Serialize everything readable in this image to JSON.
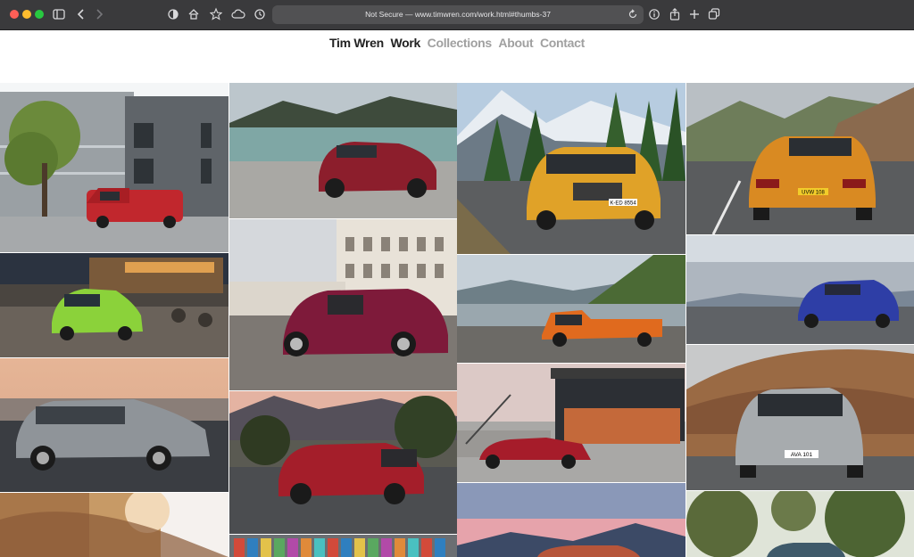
{
  "browser": {
    "url_text": "Not Secure — www.timwren.com/work.html#thumbs-37"
  },
  "nav": {
    "owner": "Tim Wren",
    "items": [
      {
        "label": "Work",
        "active": true
      },
      {
        "label": "Collections",
        "active": false
      },
      {
        "label": "About",
        "active": false
      },
      {
        "label": "Contact",
        "active": false
      }
    ]
  },
  "gallery": {
    "thumbs": [
      {
        "subject": "red van by office building",
        "plate": ""
      },
      {
        "subject": "red SUV by mountain lake",
        "plate": ""
      },
      {
        "subject": "orange SUV on mountain road",
        "plate": "K-ED 8554"
      },
      {
        "subject": "orange SUV rear on highway",
        "plate": "UVW 108"
      },
      {
        "subject": "lime green hatchback at café",
        "plate": ""
      },
      {
        "subject": "burgundy hatchback in piazza",
        "plate": ""
      },
      {
        "subject": "orange pickup in valley",
        "plate": ""
      },
      {
        "subject": "blue hatchback by the sea",
        "plate": ""
      },
      {
        "subject": "grey MPV at sunset",
        "plate": ""
      },
      {
        "subject": "red hatchback over town",
        "plate": ""
      },
      {
        "subject": "red convertible at modern house",
        "plate": ""
      },
      {
        "subject": "silver MPV on road",
        "plate": "AVA 101"
      },
      {
        "subject": "blurred road scene",
        "plate": ""
      },
      {
        "subject": "colourful facade",
        "plate": ""
      },
      {
        "subject": "car at dusk by sea",
        "plate": ""
      },
      {
        "subject": "car among pine trees",
        "plate": ""
      }
    ]
  }
}
